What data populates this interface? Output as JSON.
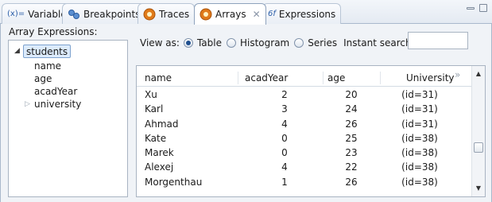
{
  "tabs": [
    {
      "label": "Variables",
      "icon": "variables-icon",
      "prefix": "(x)="
    },
    {
      "label": "Breakpoints",
      "icon": "breakpoints-icon"
    },
    {
      "label": "Traces",
      "icon": "traces-icon"
    },
    {
      "label": "Arrays",
      "icon": "arrays-icon",
      "active": true
    },
    {
      "label": "Expressions",
      "icon": "expressions-icon",
      "prefix": "6f"
    }
  ],
  "left_panel": {
    "title": "Array Expressions:",
    "tree": {
      "root": "students",
      "children": [
        "name",
        "age",
        "acadYear",
        "university"
      ]
    }
  },
  "view": {
    "label": "View as:",
    "options": [
      "Table",
      "Histogram",
      "Series"
    ],
    "selected": "Table",
    "search_label": "Instant search:",
    "search_value": ""
  },
  "table": {
    "columns": [
      "name",
      "acadYear",
      "age",
      "University"
    ],
    "rows": [
      [
        "Xu",
        "2",
        "20",
        "(id=31)"
      ],
      [
        "Karl",
        "3",
        "24",
        "(id=31)"
      ],
      [
        "Ahmad",
        "4",
        "26",
        "(id=31)"
      ],
      [
        "Kate",
        "0",
        "25",
        "(id=38)"
      ],
      [
        "Marek",
        "0",
        "23",
        "(id=38)"
      ],
      [
        "Alexej",
        "4",
        "22",
        "(id=38)"
      ],
      [
        "Morgenthau",
        "1",
        "26",
        "(id=38)"
      ]
    ]
  },
  "colors": {
    "accent": "#1f4f8f",
    "selection_bg": "#dcebfc",
    "panel_bg": "#f0f3f7",
    "tab_orange": "#e07a1a"
  }
}
